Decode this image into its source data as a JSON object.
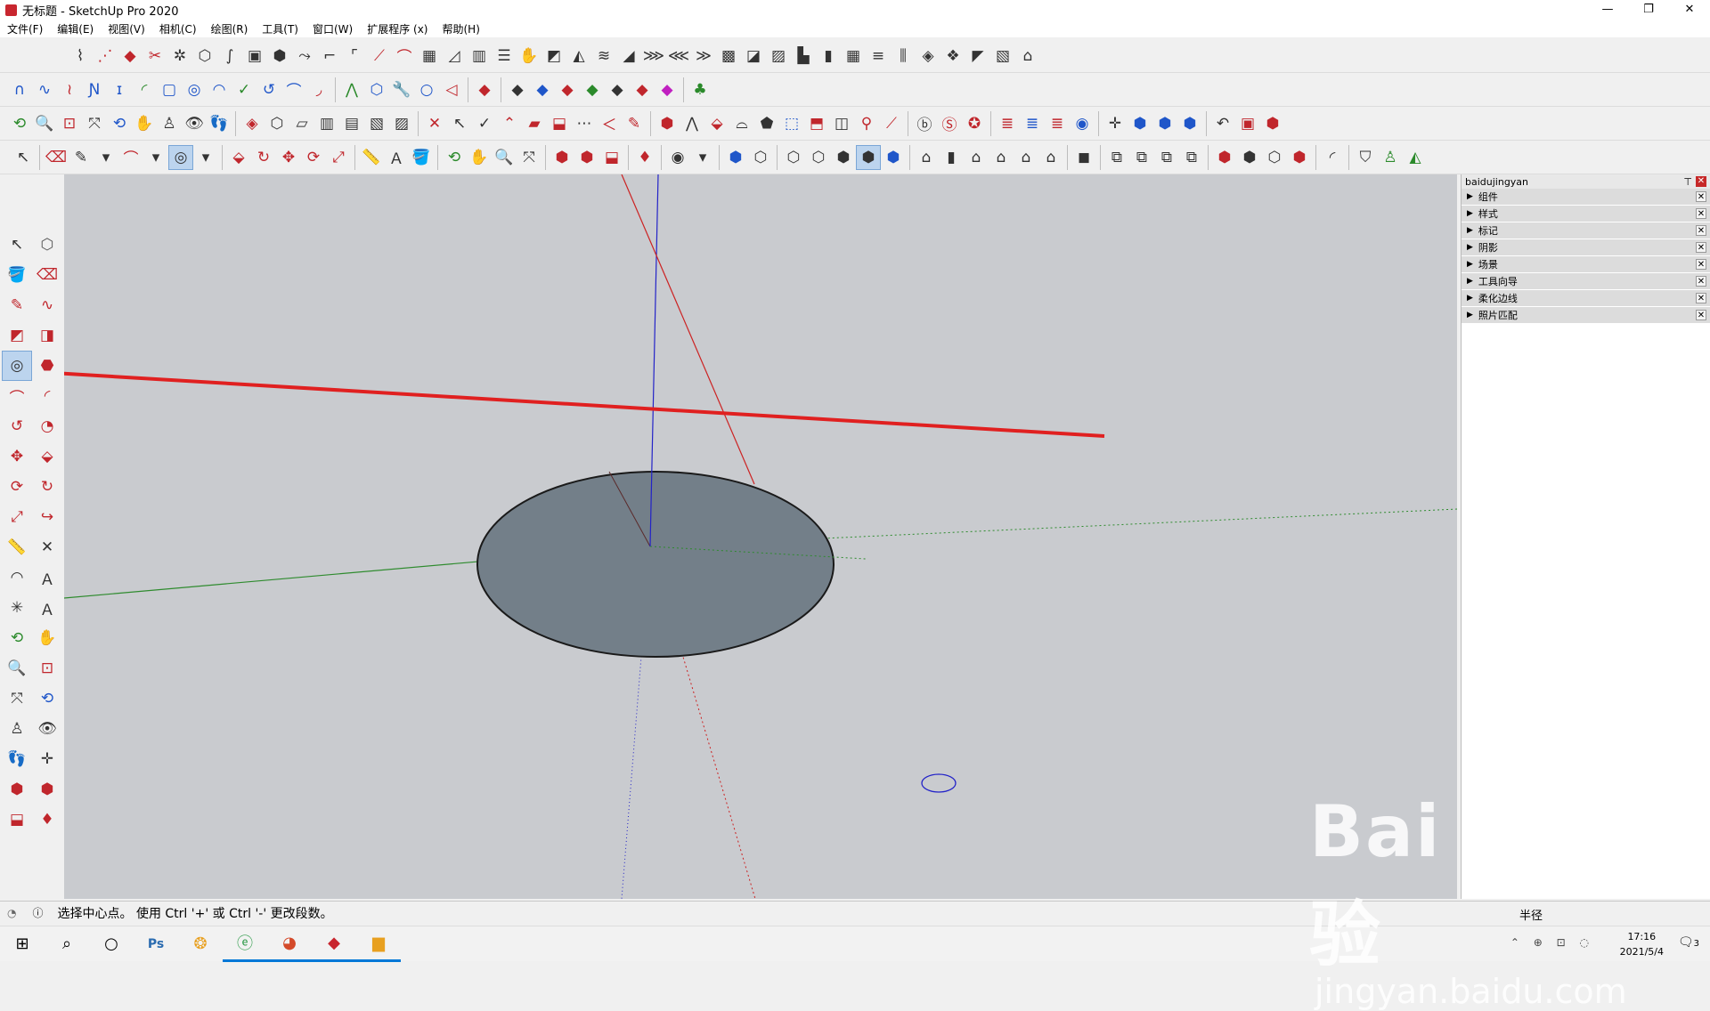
{
  "window": {
    "title": "无标题 - SketchUp Pro 2020"
  },
  "menu": {
    "items": [
      "文件(F)",
      "编辑(E)",
      "视图(V)",
      "相机(C)",
      "绘图(R)",
      "工具(T)",
      "窗口(W)",
      "扩展程序 (x)",
      "帮助(H)"
    ]
  },
  "panel": {
    "title": "baidujingyan",
    "trays": [
      "组件",
      "样式",
      "标记",
      "阴影",
      "场景",
      "工具向导",
      "柔化边线",
      "照片匹配"
    ]
  },
  "status": {
    "message": "选择中心点。 使用 Ctrl '+' 或 Ctrl '-' 更改段数。",
    "measure_label": "半径"
  },
  "taskbar": {
    "time": "17:16",
    "date": "2021/5/4",
    "notification_count": "3"
  },
  "watermark": {
    "brand": "Bai du 经验",
    "url": "jingyan.baidu.com"
  },
  "colors": {
    "viewport": "#c9cbcf",
    "circle_face": "#737f89",
    "red_axis": "#cc2222",
    "blue_axis": "#2323c8",
    "green_axis": "#2e8b2e",
    "annotation_line": "#e02020"
  }
}
